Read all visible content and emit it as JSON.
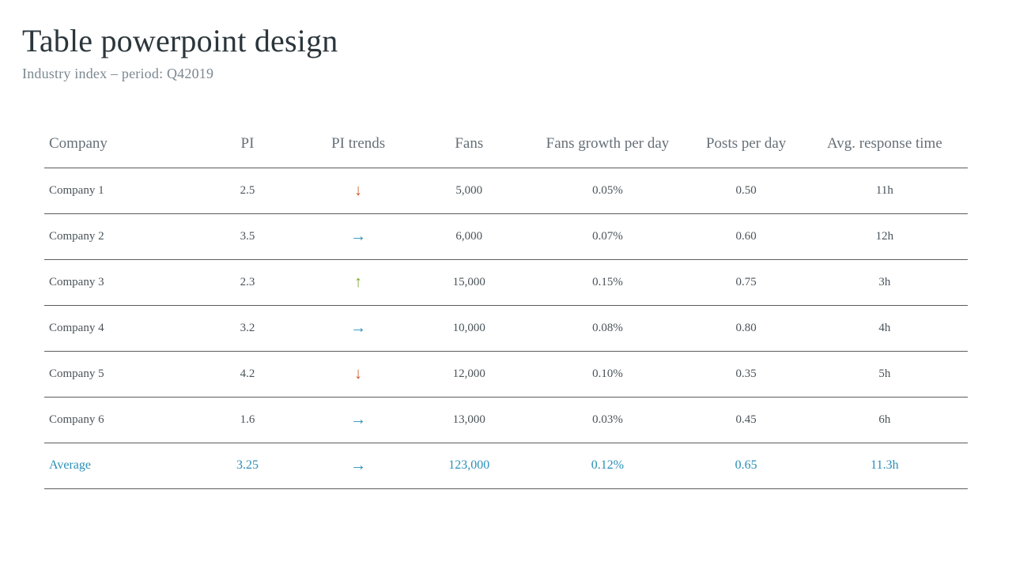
{
  "header": {
    "title": "Table powerpoint design",
    "subtitle": "Industry index – period: Q42019"
  },
  "columns": {
    "company": "Company",
    "pi": "PI",
    "trend": "PI trends",
    "fans": "Fans",
    "growth": "Fans growth per day",
    "posts": "Posts per day",
    "resp": "Avg. response time"
  },
  "rows": [
    {
      "company": "Company 1",
      "pi": "2.5",
      "trend": "down",
      "fans": "5,000",
      "growth": "0.05%",
      "posts": "0.50",
      "resp": "11h"
    },
    {
      "company": "Company 2",
      "pi": "3.5",
      "trend": "right",
      "fans": "6,000",
      "growth": "0.07%",
      "posts": "0.60",
      "resp": "12h"
    },
    {
      "company": "Company 3",
      "pi": "2.3",
      "trend": "up",
      "fans": "15,000",
      "growth": "0.15%",
      "posts": "0.75",
      "resp": "3h"
    },
    {
      "company": "Company 4",
      "pi": "3.2",
      "trend": "right",
      "fans": "10,000",
      "growth": "0.08%",
      "posts": "0.80",
      "resp": "4h"
    },
    {
      "company": "Company 5",
      "pi": "4.2",
      "trend": "down",
      "fans": "12,000",
      "growth": "0.10%",
      "posts": "0.35",
      "resp": "5h"
    },
    {
      "company": "Company 6",
      "pi": "1.6",
      "trend": "right",
      "fans": "13,000",
      "growth": "0.03%",
      "posts": "0.45",
      "resp": "6h"
    }
  ],
  "average": {
    "label": "Average",
    "pi": "3.25",
    "trend": "right",
    "fans": "123,000",
    "growth": "0.12%",
    "posts": "0.65",
    "resp": "11.3h"
  },
  "glyphs": {
    "down": "↓",
    "right": "→",
    "up": "↑"
  },
  "chart_data": {
    "type": "table",
    "title": "Table powerpoint design",
    "subtitle": "Industry index – period: Q42019",
    "columns": [
      "Company",
      "PI",
      "PI trends",
      "Fans",
      "Fans growth per day",
      "Posts per day",
      "Avg. response time"
    ],
    "rows": [
      [
        "Company 1",
        2.5,
        "down",
        5000,
        0.0005,
        0.5,
        "11h"
      ],
      [
        "Company 2",
        3.5,
        "flat",
        6000,
        0.0007,
        0.6,
        "12h"
      ],
      [
        "Company 3",
        2.3,
        "up",
        15000,
        0.0015,
        0.75,
        "3h"
      ],
      [
        "Company 4",
        3.2,
        "flat",
        10000,
        0.0008,
        0.8,
        "4h"
      ],
      [
        "Company 5",
        4.2,
        "down",
        12000,
        0.001,
        0.35,
        "5h"
      ],
      [
        "Company 6",
        1.6,
        "flat",
        13000,
        0.0003,
        0.45,
        "6h"
      ]
    ],
    "summary": [
      "Average",
      3.25,
      "flat",
      123000,
      0.0012,
      0.65,
      "11.3h"
    ]
  }
}
